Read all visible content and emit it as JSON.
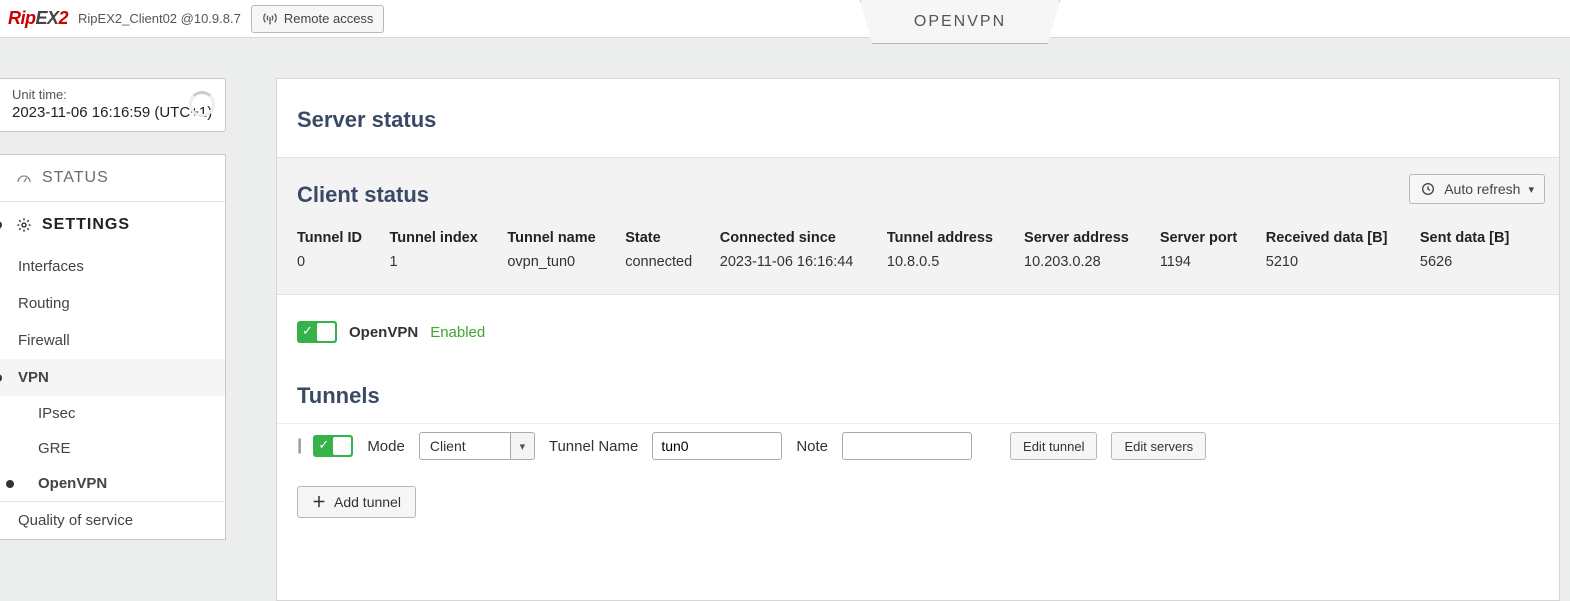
{
  "header": {
    "logo_html": "RipEX2",
    "unit": "RipEX2_Client02 @10.9.8.7",
    "remote_access": "Remote access",
    "tab": "OPENVPN"
  },
  "time_card": {
    "label": "Unit time:",
    "value": "2023-11-06 16:16:59 (UTC+1)"
  },
  "nav": {
    "status": "STATUS",
    "settings": "SETTINGS",
    "interfaces": "Interfaces",
    "routing": "Routing",
    "firewall": "Firewall",
    "vpn": "VPN",
    "ipsec": "IPsec",
    "gre": "GRE",
    "openvpn": "OpenVPN",
    "qos": "Quality of service"
  },
  "main": {
    "server_status_title": "Server status",
    "client_status_title": "Client status",
    "auto_refresh": "Auto refresh",
    "status_table": {
      "headers": {
        "tunnel_id": "Tunnel ID",
        "tunnel_index": "Tunnel index",
        "tunnel_name": "Tunnel name",
        "state": "State",
        "connected_since": "Connected since",
        "tunnel_address": "Tunnel address",
        "server_address": "Server address",
        "server_port": "Server port",
        "received": "Received data [B]",
        "sent": "Sent data [B]"
      },
      "row": {
        "tunnel_id": "0",
        "tunnel_index": "1",
        "tunnel_name": "ovpn_tun0",
        "state": "connected",
        "connected_since": "2023-11-06 16:16:44",
        "tunnel_address": "10.8.0.5",
        "server_address": "10.203.0.28",
        "server_port": "1194",
        "received": "5210",
        "sent": "5626"
      }
    },
    "openvpn_toggle_label": "OpenVPN",
    "openvpn_enabled": "Enabled",
    "tunnels_title": "Tunnels",
    "tunnel_form": {
      "mode_label": "Mode",
      "mode_value": "Client",
      "tunnel_name_label": "Tunnel Name",
      "tunnel_name_value": "tun0",
      "note_label": "Note",
      "note_value": "",
      "edit_tunnel": "Edit tunnel",
      "edit_servers": "Edit servers"
    },
    "add_tunnel": "Add tunnel"
  }
}
